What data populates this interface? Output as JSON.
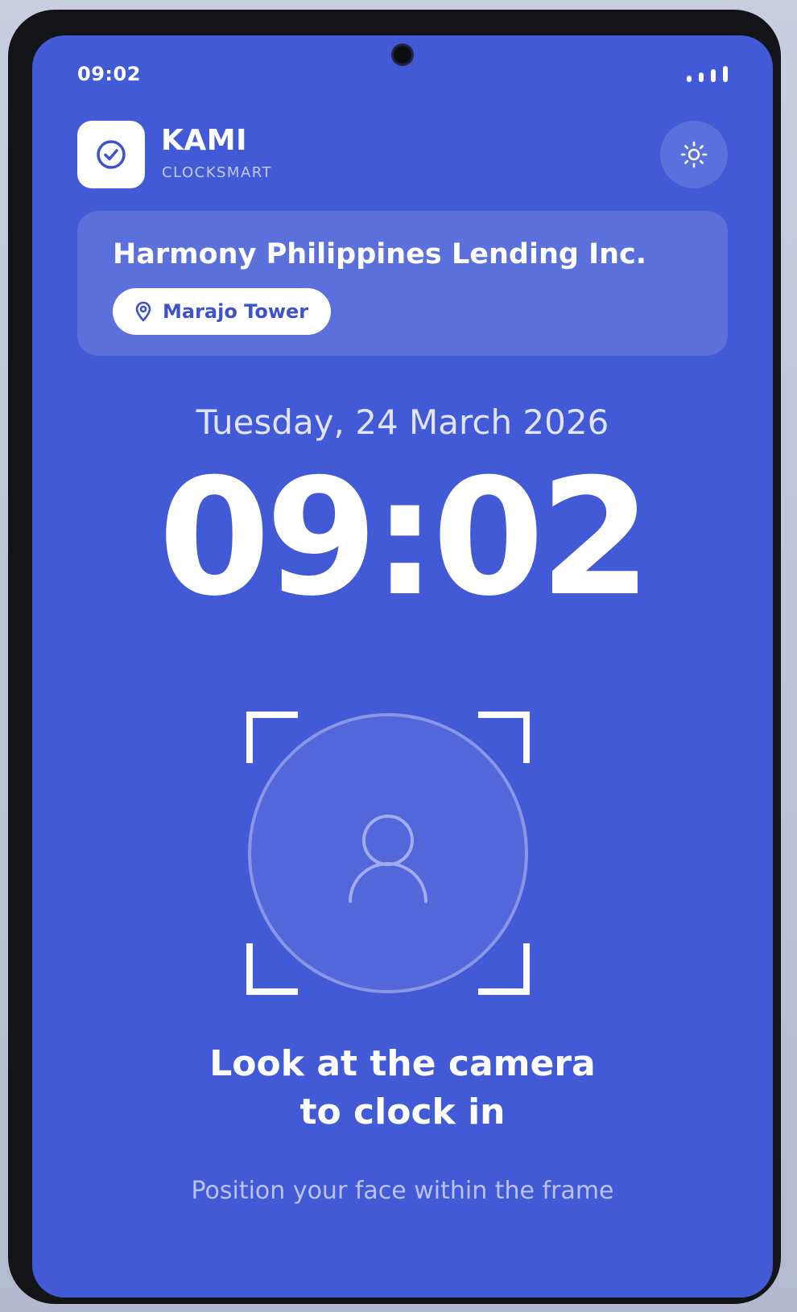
{
  "status_bar": {
    "time": "09:02"
  },
  "app": {
    "name": "KAMI",
    "subtitle": "CLOCKSMART",
    "logo_icon": "check-circle-icon",
    "theme_toggle_icon": "sun-icon"
  },
  "company": {
    "name": "Harmony Philippines Lending Inc.",
    "location": "Marajo Tower",
    "location_icon": "map-pin-icon"
  },
  "clock": {
    "date": "Tuesday, 24 March 2026",
    "time": "09:02"
  },
  "face_scan": {
    "placeholder_icon": "user-icon",
    "prompt_line1": "Look at the camera",
    "prompt_line2": "to clock in",
    "hint": "Position your face within the frame"
  },
  "colors": {
    "background": "#425ad5",
    "card": "#5b70da",
    "accent": "#3d52cc",
    "text": "#ffffff"
  }
}
